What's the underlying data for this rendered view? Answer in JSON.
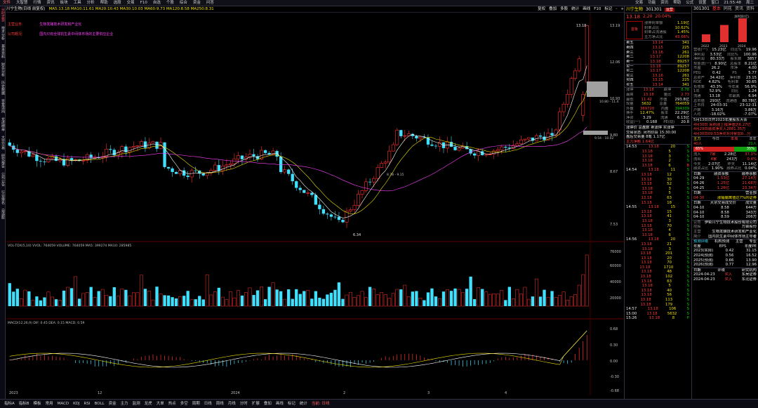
{
  "menu": {
    "items": [
      "文件",
      "大智慧",
      "行情",
      "资讯",
      "板块",
      "工具",
      "分析",
      "帮助",
      "选股",
      "交易",
      "F10",
      "自选",
      "个股",
      "综合",
      "资金",
      "问答"
    ],
    "right": [
      "交易",
      "功能",
      "资讯",
      "帮助",
      "公式",
      "设置",
      "窗口",
      "21:55:48",
      "周二"
    ]
  },
  "leftrail": {
    "items": [
      "分时走势",
      "技术分析",
      "基本资料",
      "财务分析",
      "历史数据",
      "资金流向",
      "龙虎榜单",
      "大宗交易",
      "研究报告",
      "公司公告",
      "行业排名",
      "自选股"
    ]
  },
  "chart_header": {
    "title": "川宁生物(日线 前复权)",
    "ma": "MA5:13.18  MA10:11.61  MA20:10.43  MA30:10.03  MA60:9.73  MA120:8.58  MA250:8.31",
    "tools": [
      "复权",
      "叠加",
      "多股",
      "统计",
      "画线",
      "F10",
      "标记",
      "-",
      "+"
    ]
  },
  "notes": [
    {
      "label": "主营业务:",
      "text": "生物发酵技术研发和产业化"
    },
    {
      "label": "公司概况:",
      "text": "国内只有全球抗生素中间体市场的主要供应企业"
    }
  ],
  "price_axis": [
    "13.19",
    "12.06",
    "10.93",
    "9.80",
    "8.67",
    "7.53"
  ],
  "price_marks": {
    "high": "13.18",
    "low": "6.34",
    "mid": "10.80 - 11.4",
    "mid2": "9.54 - 10.02",
    "mid3": "8.78 - 9.15"
  },
  "vol_header": "VOL-TDX(5,10)  VVOL: 764059  VOLUME: 764059  MA5: 399274  MA10: 285985",
  "vol_axis": [
    "76000",
    "60000",
    "40000",
    "20000"
  ],
  "macd_header": "MACD(12,26,9)  DIF: 0.45  DEA: 0.15  MACD: 0.59",
  "macd_axis": [
    "0.68",
    "0.30",
    "0.00",
    "-0.30",
    "-0.68"
  ],
  "x_axis": [
    "2023",
    "12",
    "2024",
    "2",
    "3",
    "4"
  ],
  "quote": {
    "name": "川宁生物",
    "code": "301301",
    "badge": "运营",
    "price": "13.18",
    "chg": "2.20",
    "pct": "20.04%",
    "tag": "首板",
    "stats": [
      [
        "涨停封单额",
        "1.19亿"
      ],
      [
        "封单占比",
        "10.62%"
      ],
      [
        "封单占流通股",
        "1.45%"
      ],
      [
        "主力净占比",
        "43.66%"
      ]
    ],
    "asks": [
      [
        "卖五",
        "13.14",
        "341"
      ],
      [
        "卖四",
        "13.15",
        "225"
      ],
      [
        "卖三",
        "13.16",
        "261"
      ],
      [
        "卖二",
        "13.17",
        "12208"
      ],
      [
        "卖一",
        "13.18",
        "89257"
      ]
    ],
    "bids": [
      [
        "买一",
        "13.18",
        "89257"
      ],
      [
        "买二",
        "13.17",
        "12208"
      ],
      [
        "买三",
        "13.16",
        "261"
      ],
      [
        "买四",
        "13.15",
        "225"
      ],
      [
        "买五",
        "13.14",
        "341"
      ]
    ],
    "fields": [
      [
        "涨停",
        "13.18",
        "跌停",
        "8.78"
      ],
      [
        "最高",
        "13.18",
        "量比",
        "2.73"
      ],
      [
        "最低",
        "11.42",
        "市值",
        "293.8亿"
      ],
      [
        "现量",
        "5632",
        "总量",
        "764059"
      ],
      [
        "外盘",
        "369720",
        "内盘",
        "394339"
      ],
      [
        "换手",
        "12.47%",
        "股本",
        "22.29亿"
      ],
      [
        "净资",
        "3.29",
        "流通",
        "6.13亿"
      ],
      [
        "收益(一)",
        "0.168",
        "PE(动)",
        "20.8"
      ]
    ],
    "extra": [
      "涨停价 总盘数 卖涨停 买涨停",
      "交易状态: 闭市阶段 15:30:00",
      "盘后交易量 8笔 1.17亿",
      "主力净额 1.64亿"
    ]
  },
  "ticks": [
    {
      "t": "14:53",
      "p": "13.18",
      "v": "20",
      "s": "S"
    },
    {
      "t": "",
      "p": "13.18",
      "v": "5",
      "s": "S"
    },
    {
      "t": "",
      "p": "13.18",
      "v": "3",
      "s": "S"
    },
    {
      "t": "",
      "p": "13.18",
      "v": "2",
      "s": "S"
    },
    {
      "t": "",
      "p": "13.18",
      "v": "6",
      "s": "B"
    },
    {
      "t": "14:54",
      "p": "13.18",
      "v": "11",
      "s": "S"
    },
    {
      "t": "",
      "p": "13.18",
      "v": "12",
      "s": "S"
    },
    {
      "t": "",
      "p": "13.18",
      "v": "30",
      "s": "S"
    },
    {
      "t": "",
      "p": "13.18",
      "v": "52",
      "s": "S"
    },
    {
      "t": "",
      "p": "13.18",
      "v": "3",
      "s": "S"
    },
    {
      "t": "",
      "p": "13.18",
      "v": "5",
      "s": "S"
    },
    {
      "t": "",
      "p": "13.18",
      "v": "63",
      "s": "S"
    },
    {
      "t": "",
      "p": "13.18",
      "v": "18",
      "s": "S"
    },
    {
      "t": "14:55",
      "p": "13.18",
      "v": "15",
      "s": "S"
    },
    {
      "t": "",
      "p": "13.18",
      "v": "15",
      "s": "S"
    },
    {
      "t": "",
      "p": "13.18",
      "v": "41",
      "s": "S"
    },
    {
      "t": "",
      "p": "13.18",
      "v": "3",
      "s": "S"
    },
    {
      "t": "",
      "p": "13.18",
      "v": "70",
      "s": "S"
    },
    {
      "t": "",
      "p": "13.18",
      "v": "4",
      "s": "S"
    },
    {
      "t": "",
      "p": "13.18",
      "v": "6",
      "s": "S"
    },
    {
      "t": "14:56",
      "p": "13.18",
      "v": "20",
      "s": "S"
    },
    {
      "t": "",
      "p": "13.18",
      "v": "21",
      "s": "S"
    },
    {
      "t": "",
      "p": "13.18",
      "v": "3",
      "s": "S"
    },
    {
      "t": "",
      "p": "13.18",
      "v": "201",
      "s": "S"
    },
    {
      "t": "",
      "p": "13.18",
      "v": "20",
      "s": "S"
    },
    {
      "t": "",
      "p": "13.18",
      "v": "70",
      "s": "S"
    },
    {
      "t": "",
      "p": "13.18",
      "v": "1710",
      "s": "S"
    },
    {
      "t": "",
      "p": "13.18",
      "v": "48",
      "s": "S"
    },
    {
      "t": "",
      "p": "13.18",
      "v": "102",
      "s": "S"
    },
    {
      "t": "",
      "p": "13.18",
      "v": "63",
      "s": "S"
    },
    {
      "t": "",
      "p": "13.18",
      "v": "5",
      "s": "S"
    },
    {
      "t": "",
      "p": "13.18",
      "v": "40",
      "s": "S"
    },
    {
      "t": "",
      "p": "13.18",
      "v": "56",
      "s": "S"
    },
    {
      "t": "",
      "p": "13.18",
      "v": "113",
      "s": "S"
    },
    {
      "t": "",
      "p": "13.18",
      "v": "179",
      "s": "S"
    },
    {
      "t": "14:57",
      "p": "13.18",
      "v": "106",
      "s": "S"
    },
    {
      "t": "15:00",
      "p": "13.18",
      "v": "5632",
      "s": "S"
    },
    {
      "t": "15:26",
      "p": "13.18",
      "v": "8",
      "s": "P"
    }
  ],
  "fund": {
    "code": "301301",
    "tabs": [
      "基本",
      "同花",
      "资讯",
      "资料"
    ],
    "chart_label": "净利润(亿)",
    "bars": [
      {
        "year": "2022",
        "value": 1.55
      },
      {
        "year": "2023",
        "value": 3.39
      },
      {
        "year": "2024",
        "value": 4.7
      }
    ],
    "rows": [
      [
        "营收(一)",
        "15.23亿",
        "同比%",
        "19.96"
      ],
      [
        "净利润",
        "3.53亿",
        "同比%",
        "100.96"
      ],
      [
        "净利润",
        "80.33万",
        "股东数",
        "3857"
      ],
      [
        "现金流(一)",
        "8.90亿",
        "总股本",
        "8.21亿"
      ],
      [
        "市盈",
        "26.2",
        "市净",
        "4.00"
      ],
      [
        "PEG",
        "0.42",
        "PS",
        "5.77"
      ],
      [
        "总资产",
        "34.42亿",
        "净利率",
        "23.15"
      ],
      [
        "ROE",
        "4.82%",
        "毛利率",
        "30.65"
      ],
      [
        "负债率",
        "43.3%",
        "今年来",
        "56.9%"
      ],
      [
        "1年",
        "52.9%",
        "同比",
        "1.24"
      ],
      [
        "流通",
        "13.18",
        "年最高",
        "6.94"
      ],
      [
        "总市值",
        "293亿",
        "流通值",
        "80.78亿"
      ],
      [
        "上市日",
        "24-03-31",
        "",
        "23-12-31"
      ],
      [
        "户数",
        "3.16万",
        "",
        "3.86万"
      ],
      [
        "人均",
        "-18.02%",
        "",
        "-7.07%"
      ]
    ],
    "news": [
      "5月13日日开2023年度股东大会",
      "4月30日 采购涨上报净值达6.27亿",
      "4月29日融资净买入2881.35万",
      "4月30日09:53净买对冲累加0...分"
    ],
    "flow": {
      "title": "主力",
      "tabs": [
        "今日",
        "本周",
        "本年"
      ],
      "in": "40人",
      "out": "21人",
      "pct_in": "65%",
      "pct_out": "35%"
    },
    "flow_rows": [
      [
        "流入",
        "7家",
        "2.28亿",
        "37.1%"
      ],
      [
        "流出",
        "4家",
        "243万",
        "0.4%"
      ]
    ],
    "flow2": [
      [
        "今天",
        "2.07亿",
        "昨天",
        "11.14亿"
      ],
      [
        "融资占比",
        "1.90%",
        "融券占比",
        "0.04%"
      ]
    ],
    "margin_head": [
      "日期",
      "融资余额",
      "融券余额"
    ],
    "margin": [
      [
        "04-29",
        "1.53亿",
        "27.14万"
      ],
      [
        "04-26",
        "1.25亿",
        "21.68万"
      ],
      [
        "04-25",
        "1.26亿",
        "23.34万"
      ]
    ],
    "lhb": [
      "日期",
      "营业部",
      "04-30",
      "涨幅偏离值达7%的证券"
    ],
    "holders_head": [
      "日期",
      "大宗交易成交价",
      "成交量"
    ],
    "holders": [
      [
        "04-10",
        "8.58",
        "644万"
      ],
      [
        "04-10",
        "8.58",
        "343万"
      ],
      [
        "04-10",
        "8.59",
        "206万"
      ]
    ],
    "biz": [
      "公司",
      "伊犁川宁生物技术股份有限公司",
      "控股",
      "万霖股份",
      "主营",
      "生物发酵技术研发和产业化",
      "简介",
      "国内抗生素中间体市场主导者"
    ],
    "fc_title": "预测评级",
    "fc_tabs": [
      "机构预测",
      "主营",
      "专业"
    ],
    "forecast_head": [
      "年度",
      "EPS",
      "年度PE"
    ],
    "forecast": [
      [
        "2023(实际)",
        "0.42",
        "31.15"
      ],
      [
        "2024(预测)",
        "0.56",
        "16.52"
      ],
      [
        "2025(预测)",
        "0.66",
        "13.90"
      ],
      [
        "2026(预测)",
        "0.77",
        "12.96"
      ]
    ],
    "rating_head": [
      "日期",
      "评级",
      "研究机构"
    ],
    "rating": [
      [
        "2024-04-23",
        "买入",
        "东吴证券"
      ],
      [
        "2024-04-23",
        "买入",
        "东北证券"
      ]
    ]
  },
  "bottombar": {
    "items": [
      "指标A",
      "指标B",
      "模板",
      "常用",
      "MACD",
      "KDJ",
      "RSI",
      "BOLL",
      "资金",
      "主力",
      "监测",
      "龙虎",
      "大单",
      "热点",
      "多空",
      "周期",
      "日线",
      "周线",
      "月线",
      "分时",
      "扩展",
      "叠加",
      "画线",
      "标记",
      "统计"
    ],
    "hl": "当前: 日线"
  }
}
